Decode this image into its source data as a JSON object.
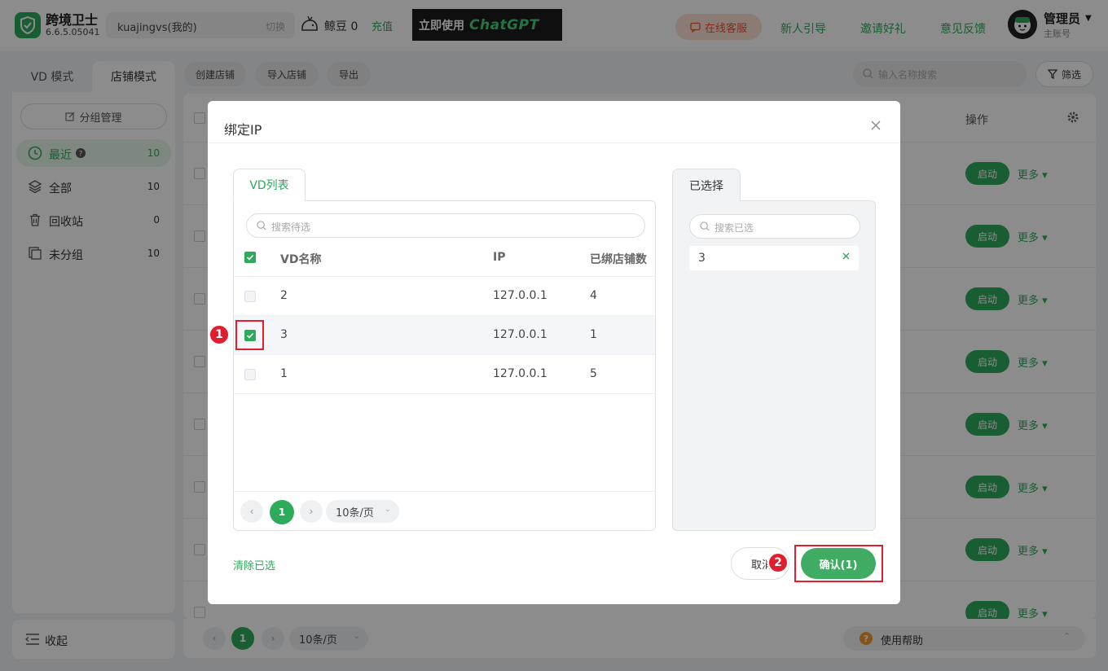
{
  "header": {
    "app_name": "跨境卫士",
    "app_version": "6.6.5.05041",
    "account_name": "kuajingvs(我的)",
    "account_switch": "切换",
    "beans_label": "鲸豆 0",
    "recharge": "充值",
    "banner_text": "立即使用",
    "banner_brand": "ChatGPT",
    "service": "在线客服",
    "nav": [
      "新人引导",
      "邀请好礼",
      "意见反馈"
    ],
    "user_name": "管理员",
    "user_role": "主账号"
  },
  "sidebar": {
    "mode_tabs": [
      "VD 模式",
      "店铺模式"
    ],
    "group_manage": "分组管理",
    "items": [
      {
        "label": "最近",
        "count": "10"
      },
      {
        "label": "全部",
        "count": "10"
      },
      {
        "label": "回收站",
        "count": "0"
      },
      {
        "label": "未分组",
        "count": "10"
      }
    ],
    "collapse": "收起"
  },
  "toolbar": {
    "buttons": [
      "创建店铺",
      "导入店铺",
      "导出"
    ],
    "search_placeholder": "输入名称搜索",
    "filter": "筛选"
  },
  "table": {
    "op_header": "操作",
    "start": "启动",
    "more": "更多"
  },
  "pagination": {
    "page": "1",
    "page_size": "10条/页",
    "help": "使用帮助"
  },
  "modal": {
    "title": "绑定IP",
    "left_tab": "VD列表",
    "left_search_placeholder": "搜索待选",
    "columns": [
      "VD名称",
      "IP",
      "已绑店铺数"
    ],
    "rows": [
      {
        "name": "2",
        "ip": "127.0.0.1",
        "count": "4",
        "checked": false
      },
      {
        "name": "3",
        "ip": "127.0.0.1",
        "count": "1",
        "checked": true
      },
      {
        "name": "1",
        "ip": "127.0.0.1",
        "count": "5",
        "checked": false
      }
    ],
    "pager_page": "1",
    "pager_size": "10条/页",
    "right_tab": "已选择",
    "right_search_placeholder": "搜索已选",
    "selected": [
      "3"
    ],
    "clear": "清除已选",
    "cancel": "取消",
    "confirm": "确认(1)"
  },
  "annotations": {
    "step1": "1",
    "step2": "2"
  },
  "colors": {
    "accent": "#2eaa5c",
    "highlight": "#e11d2e",
    "service": "#e2553c"
  }
}
